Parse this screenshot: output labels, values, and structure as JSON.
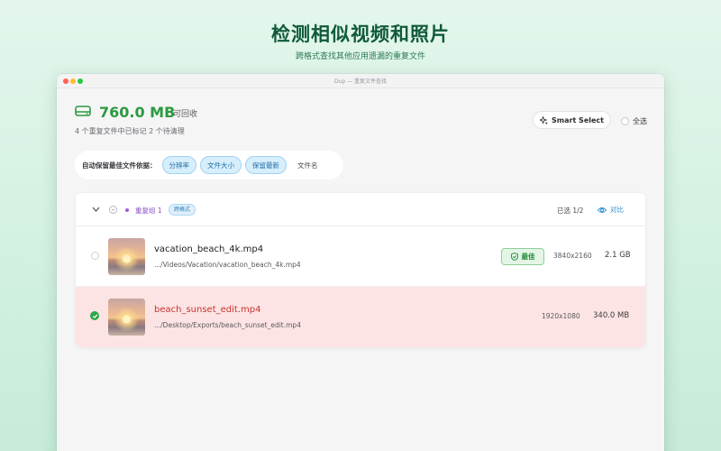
{
  "hero": {
    "title": "检测相似视频和照片",
    "subtitle": "跨格式查找其他应用遗漏的重复文件"
  },
  "window": {
    "title": "Dup — 重复文件查找"
  },
  "summary": {
    "reclaim_size": "760.0 MB",
    "reclaim_label": "可回收",
    "detail": "4 个重复文件中已标记 2 个待清理"
  },
  "toolbar": {
    "smart_select_label": "Smart Select",
    "select_all_label": "全选"
  },
  "keep_bar": {
    "label": "自动保留最佳文件依据：",
    "options": [
      {
        "label": "分辨率",
        "active": true
      },
      {
        "label": "文件大小",
        "active": true
      },
      {
        "label": "保留最新",
        "active": true
      },
      {
        "label": "文件名",
        "active": false
      }
    ]
  },
  "group": {
    "name": "重复组 1",
    "badge": "跨格式",
    "selected": "已选 1/2",
    "compare_label": "对比",
    "files": [
      {
        "name": "vacation_beach_4k.mp4",
        "path": ".../Videos/Vacation/vacation_beach_4k.mp4",
        "resolution": "3840x2160",
        "size": "2.1 GB",
        "best_label": "最佳",
        "selected": false
      },
      {
        "name": "beach_sunset_edit.mp4",
        "path": ".../Desktop/Exports/beach_sunset_edit.mp4",
        "resolution": "1920x1080",
        "size": "340.0 MB",
        "selected": true
      }
    ]
  },
  "colors": {
    "accent_green": "#2a9a3e",
    "hero_green": "#0f5a3a",
    "selected_row": "#fde4e4",
    "chip_blue": "#d7eefc",
    "group_purple": "#8a4fc3"
  },
  "icons": {
    "disk": "hard-drive-icon",
    "smart_select": "sparkles-icon",
    "chevron": "chevron-down-icon",
    "compare": "eye-icon",
    "best": "shield-check-icon",
    "selected": "checkmark-icon"
  }
}
